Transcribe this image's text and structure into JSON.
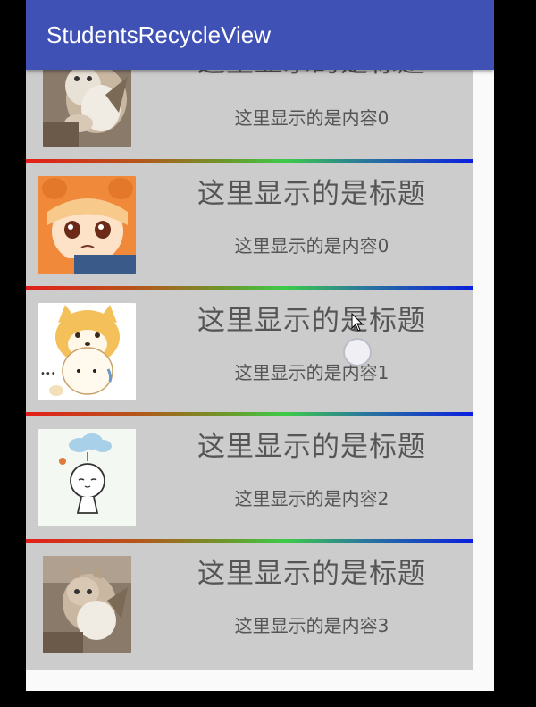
{
  "app_bar": {
    "title": "StudentsRecycleView"
  },
  "items": [
    {
      "title": "这里显示的是标题",
      "content": "这里显示的是内容0",
      "image": "kitten-photo"
    },
    {
      "title": "这里显示的是标题",
      "content": "这里显示的是内容0",
      "image": "anime-girl-umaru"
    },
    {
      "title": "这里显示的是标题",
      "content": "这里显示的是内容1",
      "image": "shiba-cartoon"
    },
    {
      "title": "这里显示的是标题",
      "content": "这里显示的是内容2",
      "image": "cloud-stick-figure"
    },
    {
      "title": "这里显示的是标题",
      "content": "这里显示的是内容3",
      "image": "kitten-photo"
    }
  ],
  "colors": {
    "app_bar": "#3f51b5",
    "item_background": "#cccccc",
    "divider_start": "#e41e1a",
    "divider_middle": "#3ccb4a",
    "divider_end": "#0a1de0",
    "text": "#555555"
  }
}
